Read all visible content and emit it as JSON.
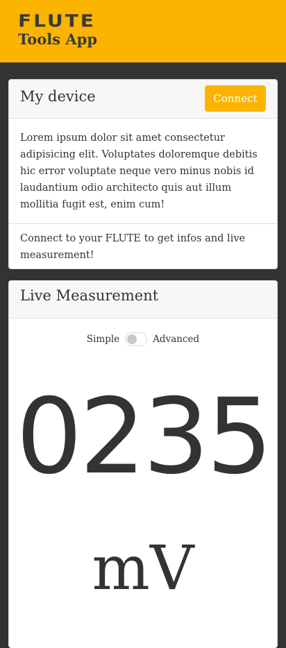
{
  "header": {
    "logo_text": "FLUTE",
    "app_title": "Tools App"
  },
  "my_device": {
    "title": "My device",
    "connect_label": "Connect",
    "description": "Lorem ipsum dolor sit amet consectetur adipisicing elit. Voluptates doloremque debitis hic error voluptate neque vero minus nobis id laudantium odio architecto quis aut illum mollitia fugit est, enim cum!",
    "footer_text": "Connect to your FLUTE to get infos and live measurement!"
  },
  "live_measurement": {
    "title": "Live Measurement",
    "mode_simple_label": "Simple",
    "mode_advanced_label": "Advanced",
    "mode_advanced_enabled": false,
    "value": "0235",
    "unit": "mV"
  },
  "colors": {
    "brand": "#FBB500",
    "background": "#333333",
    "text": "#333333"
  }
}
